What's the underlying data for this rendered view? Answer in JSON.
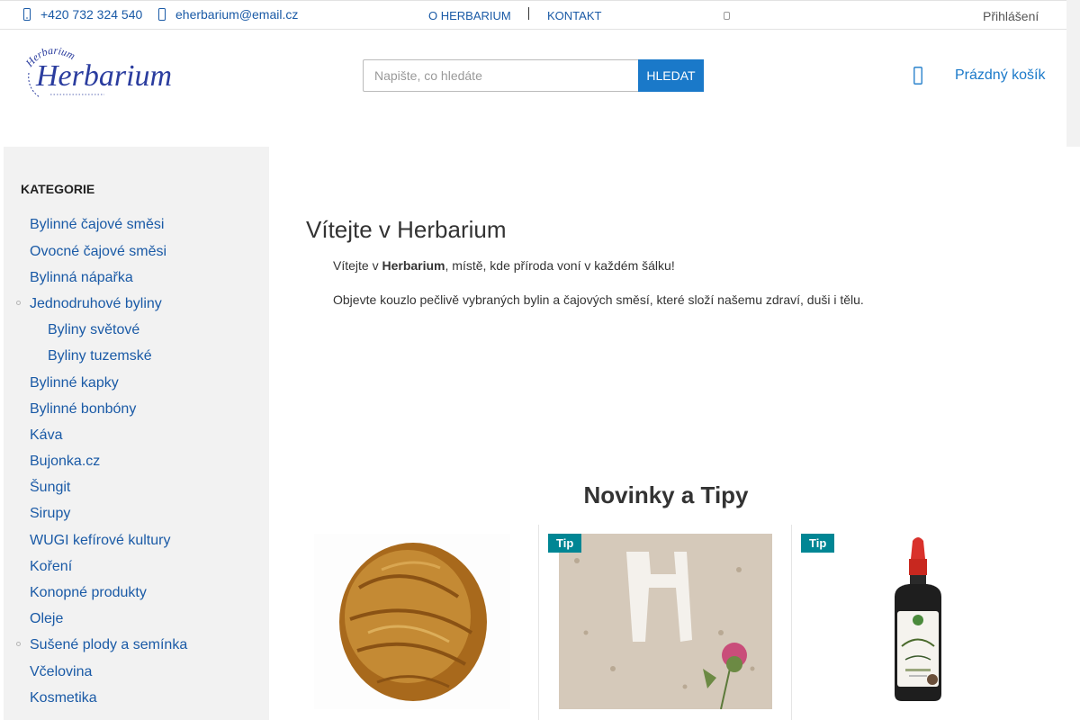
{
  "topbar": {
    "phone": "+420 732 324 540",
    "email": "eherbarium@email.cz",
    "links": [
      "O HERBARIUM",
      "KONTAKT"
    ],
    "login": "Přihlášení"
  },
  "header": {
    "logo_text": "Herbarium",
    "logo_arc_text": "Herbarium",
    "search": {
      "placeholder": "Napište, co hledáte",
      "button": "HLEDAT"
    },
    "cart_label": "Prázdný košík"
  },
  "sidebar": {
    "title": "KATEGORIE",
    "items": [
      {
        "label": "Bylinné čajové směsi"
      },
      {
        "label": "Ovocné čajové směsi"
      },
      {
        "label": "Bylinná nápařka"
      },
      {
        "label": "Jednodruhové byliny",
        "expandable": true
      },
      {
        "label": "Byliny světové",
        "sub": true
      },
      {
        "label": "Byliny tuzemské",
        "sub": true
      },
      {
        "label": "Bylinné kapky"
      },
      {
        "label": "Bylinné bonbóny"
      },
      {
        "label": "Káva"
      },
      {
        "label": "Bujonka.cz"
      },
      {
        "label": "Šungit"
      },
      {
        "label": "Sirupy"
      },
      {
        "label": "WUGI kefírové kultury"
      },
      {
        "label": "Koření"
      },
      {
        "label": "Konopné produkty"
      },
      {
        "label": "Oleje"
      },
      {
        "label": "Sušené plody a semínka",
        "expandable": true
      },
      {
        "label": "Včelovina"
      },
      {
        "label": "Kosmetika"
      }
    ]
  },
  "main": {
    "title": "Vítejte v Herbarium",
    "intro_prefix": "Vítejte v ",
    "intro_bold": "Herbarium",
    "intro_suffix": ", místě, kde příroda voní v každém šálku!",
    "intro2": "Objevte kouzlo pečlivě vybraných bylin a čajových směsí, které složí našemu zdraví, duši i tělu.",
    "section_title": "Novinky a Tipy",
    "products": [
      {
        "badge": "",
        "image": "dried-banana-chips"
      },
      {
        "badge": "Tip",
        "image": "milk-thistle-powder"
      },
      {
        "badge": "Tip",
        "image": "dropper-bottle"
      }
    ]
  },
  "colors": {
    "link": "#1a5aa6",
    "button": "#1a79c9",
    "tip_badge": "#008694",
    "sidebar_bg": "#f2f2f2"
  }
}
